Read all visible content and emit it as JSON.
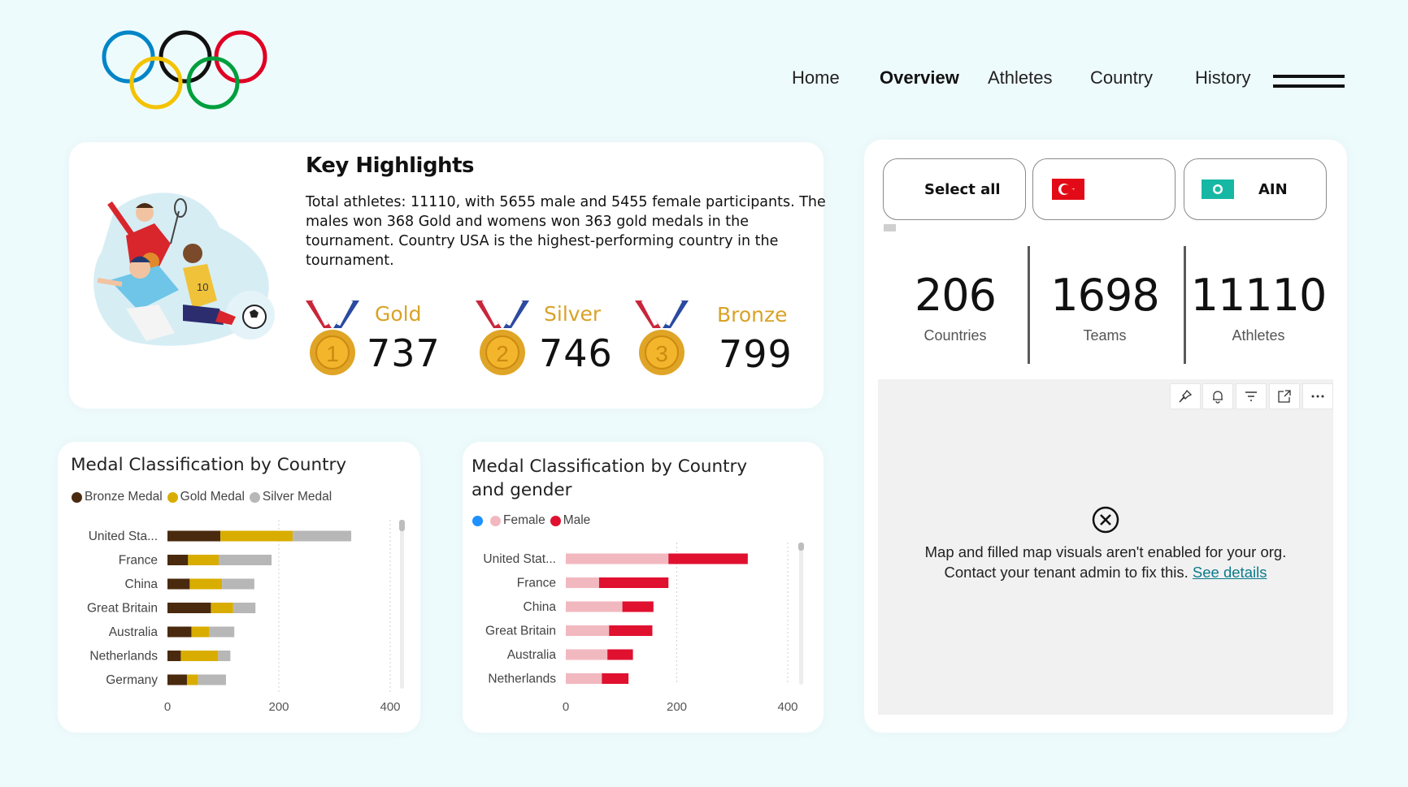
{
  "nav": {
    "items": [
      {
        "label": "Home",
        "active": false
      },
      {
        "label": "Overview",
        "active": true
      },
      {
        "label": "Athletes",
        "active": false
      },
      {
        "label": "Country",
        "active": false
      },
      {
        "label": "History",
        "active": false
      }
    ]
  },
  "highlights": {
    "title": "Key Highlights",
    "text": "Total athletes: 11110, with 5655 male and 5455 female participants. The males won 368 Gold and womens won 363 gold medals in the tournament. Country USA is the highest-performing country in the tournament.",
    "medals": [
      {
        "label": "Gold",
        "value": "737",
        "number": "1",
        "color": "#e0a526"
      },
      {
        "label": "Silver",
        "value": "746",
        "number": "2",
        "color": "#e0a526"
      },
      {
        "label": "Bronze",
        "value": "799",
        "number": "3",
        "color": "#e0a526"
      }
    ]
  },
  "slicer": {
    "select_all": "Select all",
    "chips": [
      {
        "label": "",
        "flag": "turkey-flag-icon"
      },
      {
        "label": "AIN",
        "flag": "ain-flag-icon"
      }
    ]
  },
  "kpis": [
    {
      "value": "206",
      "label": "Countries"
    },
    {
      "value": "1698",
      "label": "Teams"
    },
    {
      "value": "11110",
      "label": "Athletes"
    }
  ],
  "map": {
    "message_line1": "Map and filled map visuals aren't enabled for your org.",
    "message_line2": "Contact your tenant admin to fix this.",
    "link": "See details",
    "toolbar": [
      "pin-icon",
      "bell-icon",
      "filter-icon",
      "expand-icon",
      "more-icon"
    ]
  },
  "chart_data": [
    {
      "type": "bar",
      "orientation": "horizontal",
      "stacked": true,
      "title": "Medal Classification by Country",
      "categories": [
        "United Sta...",
        "France",
        "China",
        "Great Britain",
        "Australia",
        "Netherlands",
        "Germany"
      ],
      "series": [
        {
          "name": "Bronze Medal",
          "color": "#4a2a0e",
          "values": [
            95,
            37,
            40,
            78,
            43,
            24,
            35
          ]
        },
        {
          "name": "Gold Medal",
          "color": "#d9ad00",
          "values": [
            130,
            55,
            58,
            40,
            32,
            67,
            20
          ]
        },
        {
          "name": "Silver Medal",
          "color": "#b7b7b7",
          "values": [
            105,
            95,
            58,
            40,
            45,
            22,
            50
          ]
        }
      ],
      "xticks": [
        0,
        200,
        400
      ],
      "xlim": [
        0,
        400
      ],
      "grid": true,
      "legend": "top"
    },
    {
      "type": "bar",
      "orientation": "horizontal",
      "stacked": true,
      "title": "Medal Classification by Country and gender",
      "categories": [
        "United Stat...",
        "France",
        "China",
        "Great Britain",
        "Australia",
        "Netherlands"
      ],
      "series": [
        {
          "name": "",
          "color": "#1e90ff",
          "values": [
            0,
            0,
            0,
            0,
            0,
            0
          ]
        },
        {
          "name": "Female",
          "color": "#f2b8bf",
          "values": [
            185,
            60,
            102,
            78,
            75,
            65
          ]
        },
        {
          "name": "Male",
          "color": "#e0102f",
          "values": [
            143,
            125,
            56,
            78,
            46,
            48
          ]
        }
      ],
      "xticks": [
        0,
        200,
        400
      ],
      "xlim": [
        0,
        400
      ],
      "grid": true,
      "legend": "top"
    }
  ]
}
